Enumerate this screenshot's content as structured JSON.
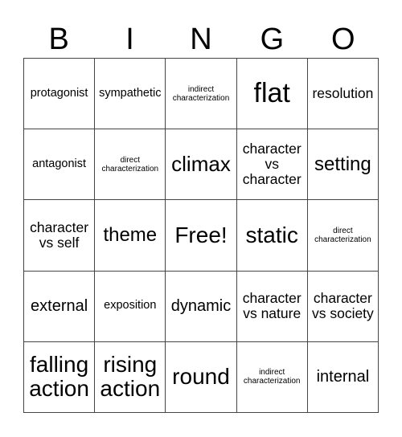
{
  "header": [
    "B",
    "I",
    "N",
    "G",
    "O"
  ],
  "cells": [
    [
      "protagonist",
      "sympathetic",
      "indirect characterization",
      "flat",
      "resolution"
    ],
    [
      "antagonist",
      "direct characterization",
      "climax",
      "character vs character",
      "setting"
    ],
    [
      "character vs self",
      "theme",
      "Free!",
      "static",
      "direct characterization"
    ],
    [
      "external",
      "exposition",
      "dynamic",
      "character vs nature",
      "character vs society"
    ],
    [
      "falling action",
      "rising action",
      "round",
      "indirect characterization",
      "internal"
    ]
  ]
}
